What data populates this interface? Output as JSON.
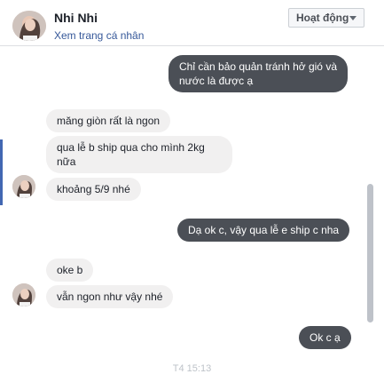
{
  "header": {
    "name": "Nhi Nhi",
    "profile_link": "Xem trang cá nhân",
    "status": "Hoạt động"
  },
  "messages": [
    {
      "from": "me",
      "text": "Chỉ cần bảo quản tránh hở gió và nước là được ạ"
    },
    {
      "from": "them",
      "text": "măng giòn rất là ngon"
    },
    {
      "from": "them",
      "text": "qua lễ b ship qua cho mình 2kg nữa"
    },
    {
      "from": "them",
      "text": "khoảng 5/9 nhé"
    },
    {
      "from": "me",
      "text": "Dạ ok c, vậy qua lễ e ship c nha"
    },
    {
      "from": "them",
      "text": "oke b"
    },
    {
      "from": "them",
      "text": "vẫn ngon như vậy nhé"
    },
    {
      "from": "me",
      "text": "Ok c ạ"
    }
  ],
  "timestamp": "T4 15:13",
  "colors": {
    "incoming_bubble": "#f1f0f0",
    "outgoing_bubble": "#4b4f56",
    "link": "#365899",
    "accent": "#4267b2"
  }
}
